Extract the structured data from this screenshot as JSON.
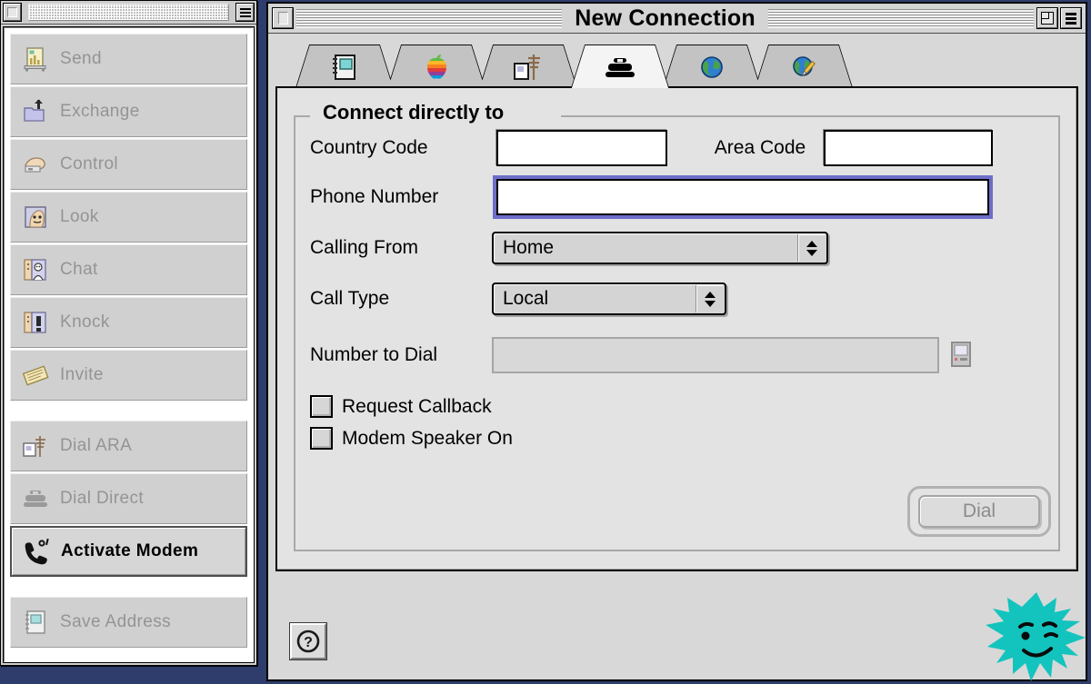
{
  "desktop": {
    "background": "#2e3d6b"
  },
  "palette": {
    "title_icon": "close-box",
    "menu_icon": "list-icon",
    "groups": [
      {
        "items": [
          {
            "label": "Send",
            "icon": "send-document-icon",
            "enabled": false
          },
          {
            "label": "Exchange",
            "icon": "exchange-folder-icon",
            "enabled": false
          },
          {
            "label": "Control",
            "icon": "control-hand-icon",
            "enabled": false
          },
          {
            "label": "Look",
            "icon": "look-face-icon",
            "enabled": false
          },
          {
            "label": "Chat",
            "icon": "chat-icon",
            "enabled": false
          },
          {
            "label": "Knock",
            "icon": "knock-icon",
            "enabled": false
          },
          {
            "label": "Invite",
            "icon": "invite-envelope-icon",
            "enabled": false
          }
        ]
      },
      {
        "items": [
          {
            "label": "Dial ARA",
            "icon": "dial-ara-tower-icon",
            "enabled": false
          },
          {
            "label": "Dial Direct",
            "icon": "telephone-icon",
            "enabled": false
          },
          {
            "label": "Activate Modem",
            "icon": "modem-phone-icon",
            "enabled": true
          }
        ]
      },
      {
        "items": [
          {
            "label": "Save Address",
            "icon": "address-book-icon",
            "enabled": false
          }
        ]
      }
    ]
  },
  "window": {
    "title": "New Connection",
    "close_label": "close-box",
    "zoom_label": "zoom-box",
    "collapse_label": "collapse-box",
    "tabs": [
      {
        "name": "address-book",
        "icon": "address-book-icon",
        "active": false
      },
      {
        "name": "apple",
        "icon": "apple-logo-icon",
        "active": false
      },
      {
        "name": "ara",
        "icon": "ara-tower-icon",
        "active": false
      },
      {
        "name": "telephone",
        "icon": "telephone-icon",
        "active": true
      },
      {
        "name": "internet",
        "icon": "globe-icon",
        "active": false
      },
      {
        "name": "setup",
        "icon": "globe-pencil-icon",
        "active": false
      }
    ],
    "group_title": "Connect directly to",
    "fields": {
      "country_code": {
        "label": "Country Code",
        "value": "",
        "placeholder": "",
        "focused": false,
        "enabled": true
      },
      "area_code": {
        "label": "Area Code",
        "value": "",
        "placeholder": "",
        "focused": false,
        "enabled": true
      },
      "phone_number": {
        "label": "Phone Number",
        "value": "",
        "placeholder": "",
        "focused": true,
        "enabled": true
      },
      "calling_from": {
        "label": "Calling From",
        "value": "Home",
        "options": [
          "Home"
        ]
      },
      "call_type": {
        "label": "Call Type",
        "value": "Local",
        "options": [
          "Local"
        ]
      },
      "number_to_dial": {
        "label": "Number to Dial",
        "value": "",
        "enabled": false,
        "helper_icon": "computer-icon"
      }
    },
    "checkboxes": [
      {
        "label": "Request Callback",
        "checked": false
      },
      {
        "label": "Modem Speaker On",
        "checked": false
      }
    ],
    "dial_button": {
      "label": "Dial",
      "enabled": false,
      "is_default": true
    },
    "help_button": {
      "label": "?"
    },
    "mascot": {
      "name": "spiky-winking-mascot",
      "color": "#12c4bd"
    }
  },
  "colors": {
    "window_bg": "#d8d8d8",
    "panel_bg": "#e3e3e3",
    "focus_ring": "#6e6ec8",
    "disabled_text": "#949494",
    "active_tab_bg": "#f4f4f4",
    "mascot": "#12c4bd"
  }
}
